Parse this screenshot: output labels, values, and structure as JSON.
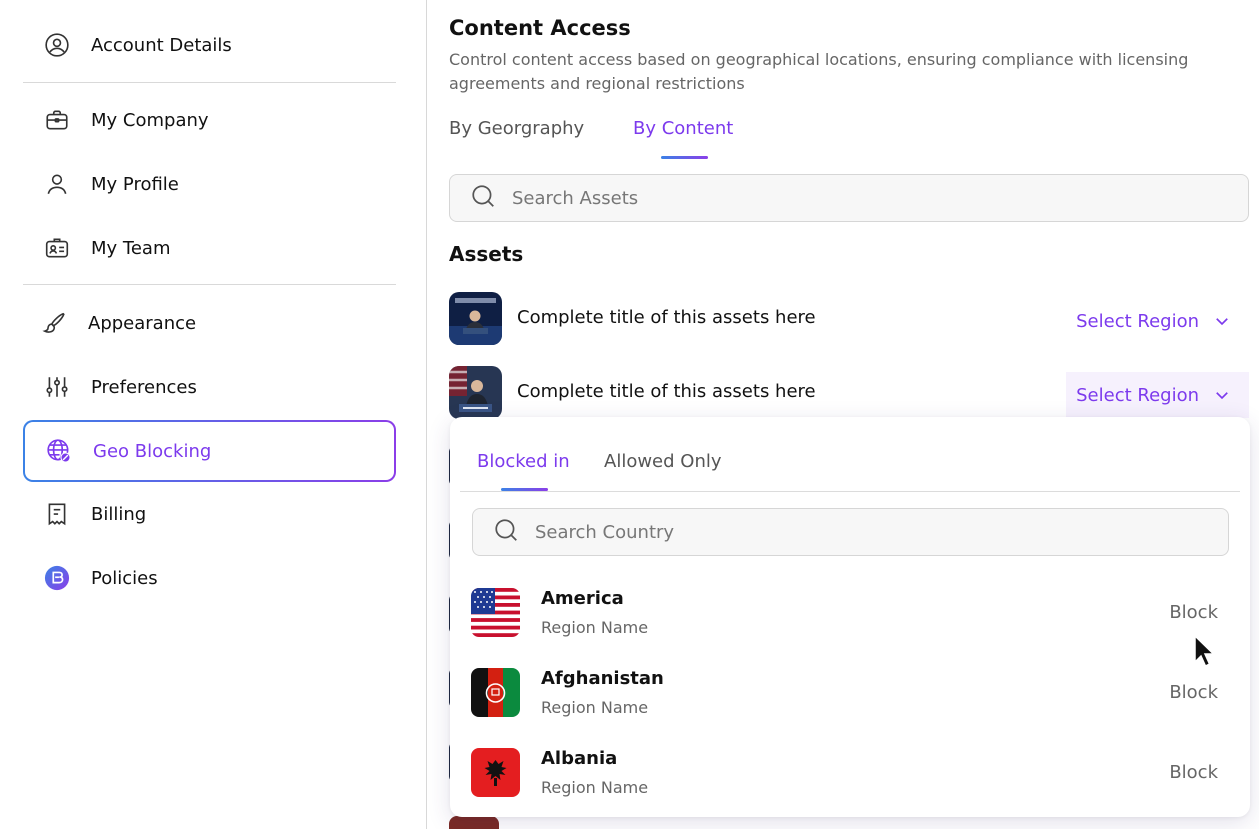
{
  "sidebar": {
    "items": [
      {
        "label": "Account Details",
        "icon": "user-circle-icon"
      },
      {
        "label": "My Company",
        "icon": "briefcase-icon"
      },
      {
        "label": "My Profile",
        "icon": "user-icon"
      },
      {
        "label": "My Team",
        "icon": "id-badge-icon"
      },
      {
        "label": "Appearance",
        "icon": "brush-icon"
      },
      {
        "label": "Preferences",
        "icon": "sliders-icon"
      },
      {
        "label": "Geo Blocking",
        "icon": "globe-block-icon",
        "active": true
      },
      {
        "label": "Billing",
        "icon": "receipt-icon"
      },
      {
        "label": "Policies",
        "icon": "shield-icon"
      }
    ]
  },
  "main": {
    "title": "Content Access",
    "description": "Control content access based on geographical locations, ensuring compliance with licensing agreements and regional restrictions",
    "tabs": [
      {
        "label": "By Georgraphy",
        "active": false
      },
      {
        "label": "By Content",
        "active": true
      }
    ],
    "search_placeholder": "Search Assets",
    "assets_heading": "Assets",
    "assets": [
      {
        "title": "Complete title of this assets here",
        "action": "Select Region"
      },
      {
        "title": "Complete title of this assets here",
        "action": "Select Region"
      }
    ]
  },
  "dropdown": {
    "tabs": [
      {
        "label": "Blocked in",
        "active": true
      },
      {
        "label": "Allowed Only",
        "active": false
      }
    ],
    "search_placeholder": "Search Country",
    "countries": [
      {
        "name": "America",
        "region": "Region Name",
        "action": "Block"
      },
      {
        "name": "Afghanistan",
        "region": "Region Name",
        "action": "Block"
      },
      {
        "name": "Albania",
        "region": "Region Name",
        "action": "Block"
      }
    ]
  },
  "colors": {
    "accent": "#7c3aed",
    "gradient_start": "#3b82e6",
    "gradient_end": "#8b3ee8"
  }
}
